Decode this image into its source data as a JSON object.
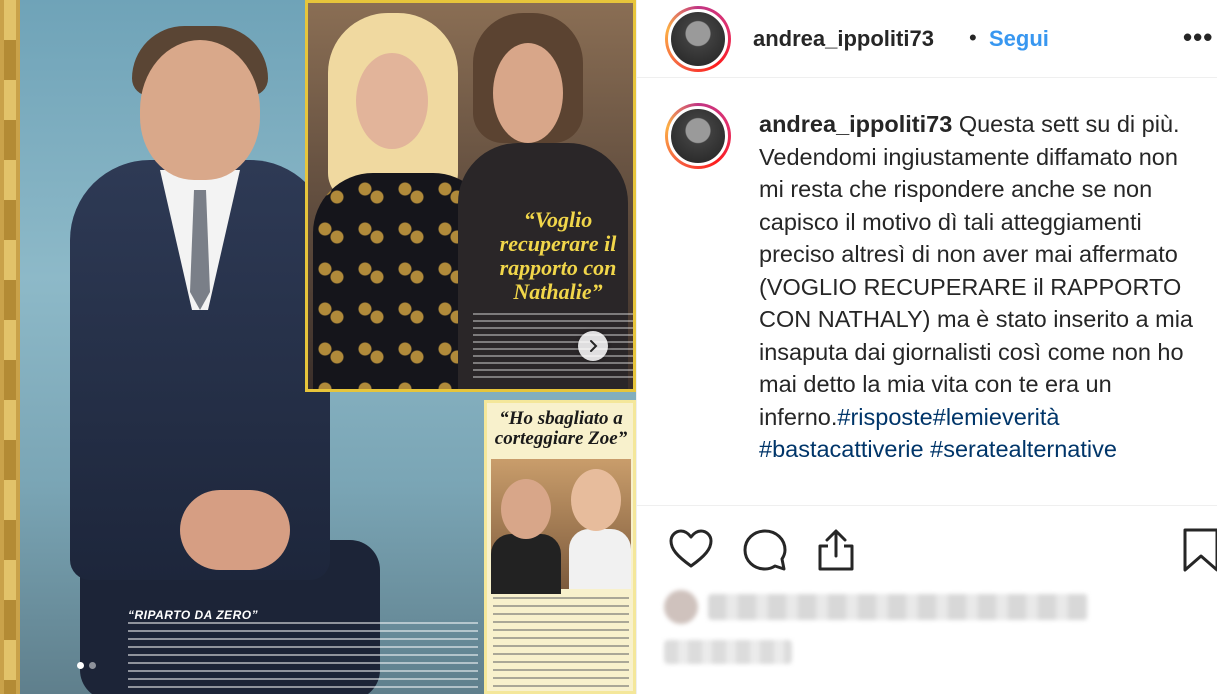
{
  "post": {
    "magazine": {
      "quote_top": "“Voglio recuperare il rapporto con Nathalie”",
      "quote_bottom": "“Ho sbagliato a corteggiare Zoe”",
      "caption_title": "“RIPARTO DA ZERO”"
    },
    "carousel": {
      "current_index": 1,
      "total": 2
    }
  },
  "header": {
    "username": "andrea_ippoliti73",
    "separator": "•",
    "follow_label": "Segui",
    "more_label": "•••"
  },
  "caption": {
    "username": "andrea_ippoliti73",
    "body": "Questa sett su di più. Vedendomi ingiustamente diffamato non mi resta che rispondere anche se non capisco il motivo dì tali atteggiamenti preciso altresì di non aver mai affermato (VOGLIO RECUPERARE il RAPPORTO CON NATHALY) ma è stato inserito a mia insaputa dai giornalisti così come non ho mai detto la mia vita con te era un inferno.",
    "hashtags": [
      "#risposte",
      "#lemieverità",
      "#bastacattiverie",
      "#seratealternative"
    ]
  },
  "actions": {
    "like_icon": "heart-icon",
    "comment_icon": "comment-icon",
    "share_icon": "share-icon",
    "save_icon": "bookmark-icon"
  },
  "colors": {
    "link_blue": "#3897f0",
    "hashtag_blue": "#003569",
    "text": "#262626",
    "divider": "#efefef"
  }
}
